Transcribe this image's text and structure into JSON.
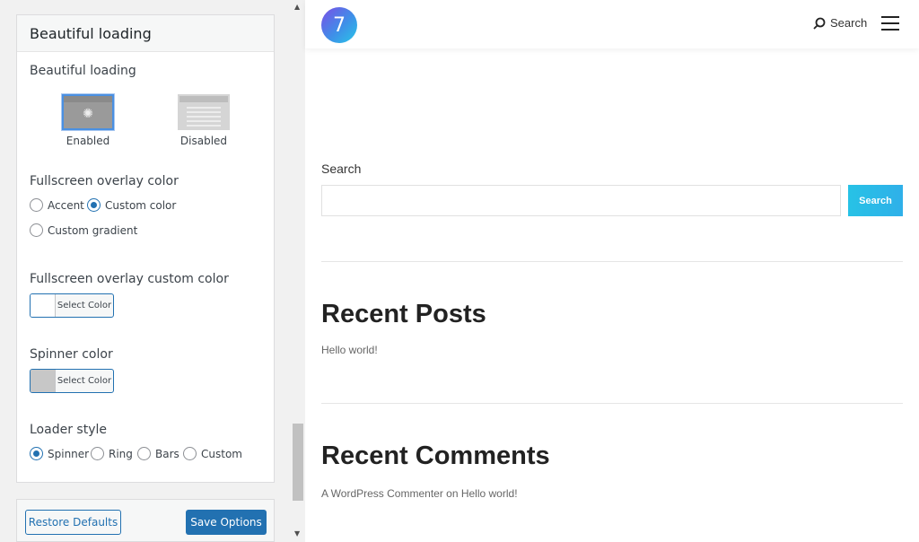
{
  "panel": {
    "header": "Beautiful loading",
    "beautiful_loading": {
      "label": "Beautiful loading",
      "options": [
        {
          "label": "Enabled",
          "selected": true
        },
        {
          "label": "Disabled",
          "selected": false
        }
      ]
    },
    "overlay_color": {
      "label": "Fullscreen overlay color",
      "options": [
        {
          "label": "Accent",
          "selected": false
        },
        {
          "label": "Custom color",
          "selected": true
        },
        {
          "label": "Custom gradient",
          "selected": false
        }
      ]
    },
    "overlay_custom_color": {
      "label": "Fullscreen overlay custom color",
      "button_label": "Select Color",
      "swatch": "#ffffff"
    },
    "spinner_color": {
      "label": "Spinner color",
      "button_label": "Select Color",
      "swatch": "#c7c7c7"
    },
    "loader_style": {
      "label": "Loader style",
      "options": [
        {
          "label": "Spinner",
          "selected": true
        },
        {
          "label": "Ring",
          "selected": false
        },
        {
          "label": "Bars",
          "selected": false
        },
        {
          "label": "Custom",
          "selected": false
        }
      ]
    }
  },
  "footer": {
    "restore_label": "Restore Defaults",
    "save_label": "Save Options"
  },
  "preview": {
    "logo_text": "7",
    "nav_search_label": "Search",
    "search_widget": {
      "label": "Search",
      "button_label": "Search"
    },
    "recent_posts": {
      "title": "Recent Posts",
      "items": [
        "Hello world!"
      ]
    },
    "recent_comments": {
      "title": "Recent Comments",
      "item": "A WordPress Commenter on Hello world!"
    }
  },
  "colors": {
    "accent": "#2271b1",
    "search_button": "#27c2e6"
  }
}
